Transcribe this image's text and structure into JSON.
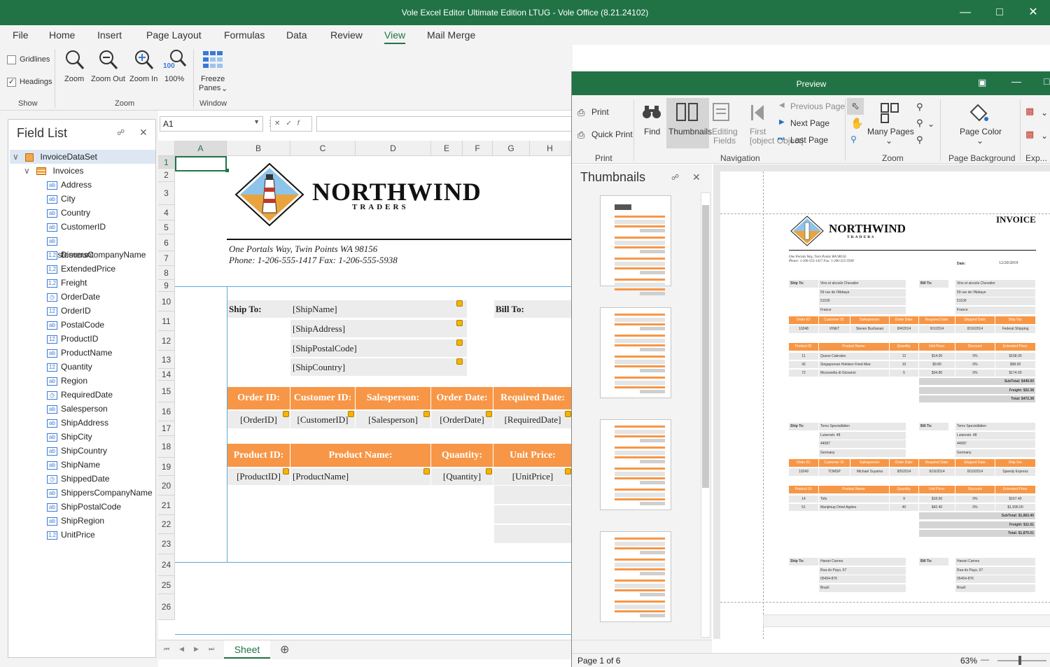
{
  "window": {
    "title": "Vole Excel Editor Ultimate Edition LTUG - Vole Office (8.21.24102)"
  },
  "menu": [
    "File",
    "Home",
    "Insert",
    "Page Layout",
    "Formulas",
    "Data",
    "Review",
    "View",
    "Mail Merge"
  ],
  "ribbon": {
    "gridlines": "Gridlines",
    "headings": "Headings",
    "show": "Show",
    "zoom": "Zoom",
    "zoom_out": "Zoom Out",
    "zoom_in": "Zoom In",
    "pct": "100%",
    "pct_badge": "100",
    "freeze": "Freeze",
    "panes": "Panes",
    "zoom_group": "Zoom",
    "window_group": "Window"
  },
  "fieldlist": {
    "title": "Field List",
    "root": "InvoiceDataSet",
    "table": "Invoices",
    "fields": [
      {
        "icon": "ab",
        "name": "Address"
      },
      {
        "icon": "ab",
        "name": "City"
      },
      {
        "icon": "ab",
        "name": "Country"
      },
      {
        "icon": "ab",
        "name": "CustomerID"
      },
      {
        "icon": "ab",
        "name": "CustomersCompanyName"
      },
      {
        "icon": "1,2",
        "name": "Discount"
      },
      {
        "icon": "1,2",
        "name": "ExtendedPrice"
      },
      {
        "icon": "1,2",
        "name": "Freight"
      },
      {
        "icon": "clock",
        "name": "OrderDate"
      },
      {
        "icon": "12",
        "name": "OrderID"
      },
      {
        "icon": "ab",
        "name": "PostalCode"
      },
      {
        "icon": "12",
        "name": "ProductID"
      },
      {
        "icon": "ab",
        "name": "ProductName"
      },
      {
        "icon": "12",
        "name": "Quantity"
      },
      {
        "icon": "ab",
        "name": "Region"
      },
      {
        "icon": "clock",
        "name": "RequiredDate"
      },
      {
        "icon": "ab",
        "name": "Salesperson"
      },
      {
        "icon": "ab",
        "name": "ShipAddress"
      },
      {
        "icon": "ab",
        "name": "ShipCity"
      },
      {
        "icon": "ab",
        "name": "ShipCountry"
      },
      {
        "icon": "ab",
        "name": "ShipName"
      },
      {
        "icon": "clock",
        "name": "ShippedDate"
      },
      {
        "icon": "ab",
        "name": "ShippersCompanyName"
      },
      {
        "icon": "ab",
        "name": "ShipPostalCode"
      },
      {
        "icon": "ab",
        "name": "ShipRegion"
      },
      {
        "icon": "1,2",
        "name": "UnitPrice"
      }
    ]
  },
  "sheet": {
    "namebox": "A1",
    "cols": [
      "A",
      "B",
      "C",
      "D",
      "E",
      "F",
      "G",
      "H"
    ],
    "rows": [
      "1",
      "2",
      "3",
      "4",
      "5",
      "6",
      "7",
      "8",
      "9",
      "10",
      "11",
      "12",
      "13",
      "14",
      "15",
      "16",
      "17",
      "18",
      "19",
      "20",
      "21",
      "22",
      "23",
      "24",
      "25",
      "26"
    ],
    "logo_main": "NORTHWIND",
    "logo_sub": "TRADERS",
    "address": "One Portals Way, Twin Points WA  98156",
    "phone": "Phone: 1-206-555-1417   Fax: 1-206-555-5938",
    "ship_to": "Ship To:",
    "bill_to": "Bill To:",
    "ship_fields": [
      "[ShipName]",
      "[ShipAddress]",
      "[ShipPostalCode]",
      "[ShipCountry]"
    ],
    "order_headers": [
      "Order ID:",
      "Customer ID:",
      "Salesperson:",
      "Order Date:",
      "Required Date:"
    ],
    "order_values": [
      "[OrderID]",
      "[CustomerID]",
      "[Salesperson]",
      "[OrderDate]",
      "[RequiredDate]"
    ],
    "product_headers": [
      "Product ID:",
      "Product Name:",
      "Quantity:",
      "Unit Price:"
    ],
    "product_values": [
      "[ProductID]",
      "[ProductName]",
      "[Quantity]",
      "[UnitPrice]"
    ],
    "tab": "Sheet"
  },
  "preview": {
    "title": "Preview",
    "print": "Print",
    "quick_print": "Quick Print",
    "print_group": "Print",
    "find": "Find",
    "thumbnails": "Thumbnails",
    "editing": "Editing",
    "fields": "Fields",
    "first": "First",
    "page": {
      "invoice": "INVOICE",
      "logo_main": "NORTHWIND",
      "logo_sub": "TRADERS",
      "date_label": "Date:",
      "date": "12/20/2019",
      "addr1": "One Portals Way, Twin Points WA  98156",
      "addr2": "Phone: 1-206-555-1417   Fax: 1-206-555-5938",
      "ship_to": "Ship To:",
      "bill_to": "Bill To:",
      "order_headers": [
        "Order ID:",
        "Customer ID:",
        "Salesperson:",
        "Order Date:",
        "Required Date:",
        "Shipped Date:",
        "Ship Via:"
      ],
      "product_headers": [
        "Product ID:",
        "Product Name:",
        "Quantity:",
        "Unit Price:",
        "Discount:",
        "Extended Price:"
      ],
      "invoices": [
        {
          "ship": [
            "Vins et alcools Chevalier",
            "59 rue de l'Abbaye",
            "51100",
            "France"
          ],
          "bill": [
            "Vins et alcools Chevalier",
            "59 rue de l'Abbaye",
            "51100",
            "France"
          ],
          "order": [
            "10248",
            "VINET",
            "Steven Buchanan",
            "8/4/2014",
            "9/1/2014",
            "8/16/2014",
            "Federal Shipping"
          ],
          "products": [
            [
              "11",
              "Queso Cabrales",
              "12",
              "$14.00",
              "0%",
              "$168.00"
            ],
            [
              "42",
              "Singaporean Hokkien Fried Mee",
              "10",
              "$9.80",
              "0%",
              "$98.00"
            ],
            [
              "72",
              "Mozzarella di Giovanni",
              "5",
              "$34.80",
              "0%",
              "$174.00"
            ]
          ],
          "subtotal": "SubTotal: $440.00",
          "freight": "Freight: $32.38",
          "total": "Total: $472.38"
        },
        {
          "ship": [
            "Toms Spezialitäten",
            "Luisenstr. 48",
            "44087",
            "Germany"
          ],
          "bill": [
            "Toms Spezialitäten",
            "Luisenstr. 48",
            "44087",
            "Germany"
          ],
          "order": [
            "10249",
            "TOMSP",
            "Michael Suyama",
            "8/5/2014",
            "9/16/2014",
            "8/10/2014",
            "Speedy Express"
          ],
          "products": [
            [
              "14",
              "Tofu",
              "9",
              "$18.60",
              "0%",
              "$167.40"
            ],
            [
              "51",
              "Manjimup Dried Apples",
              "40",
              "$42.40",
              "0%",
              "$1,696.00"
            ]
          ],
          "subtotal": "SubTotal: $1,863.40",
          "freight": "Freight: $11.61",
          "total": "Total: $1,875.01"
        },
        {
          "ship": [
            "Hanari Carnes",
            "Rua do Paço, 67",
            "05454-876",
            "Brazil"
          ],
          "bill": [
            "Hanari Carnes",
            "Rua do Paço, 67",
            "05454-876",
            "Brazil"
          ]
        }
      ]
    },
    "prev_page": "Previous Page",
    "next_page": "Next Page",
    "last_page": "Last Page",
    "nav_group": "Navigation",
    "many_pages": "Many Pages",
    "zoom_group": "Zoom",
    "page_color": "Page Color",
    "bg_group": "Page Background",
    "exp_group": "Exp...",
    "thumb_title": "Thumbnails",
    "status": "Page 1 of 6",
    "zoom_pct": "63%"
  },
  "colors": {
    "accent": "#217346",
    "orange": "#f79646"
  }
}
